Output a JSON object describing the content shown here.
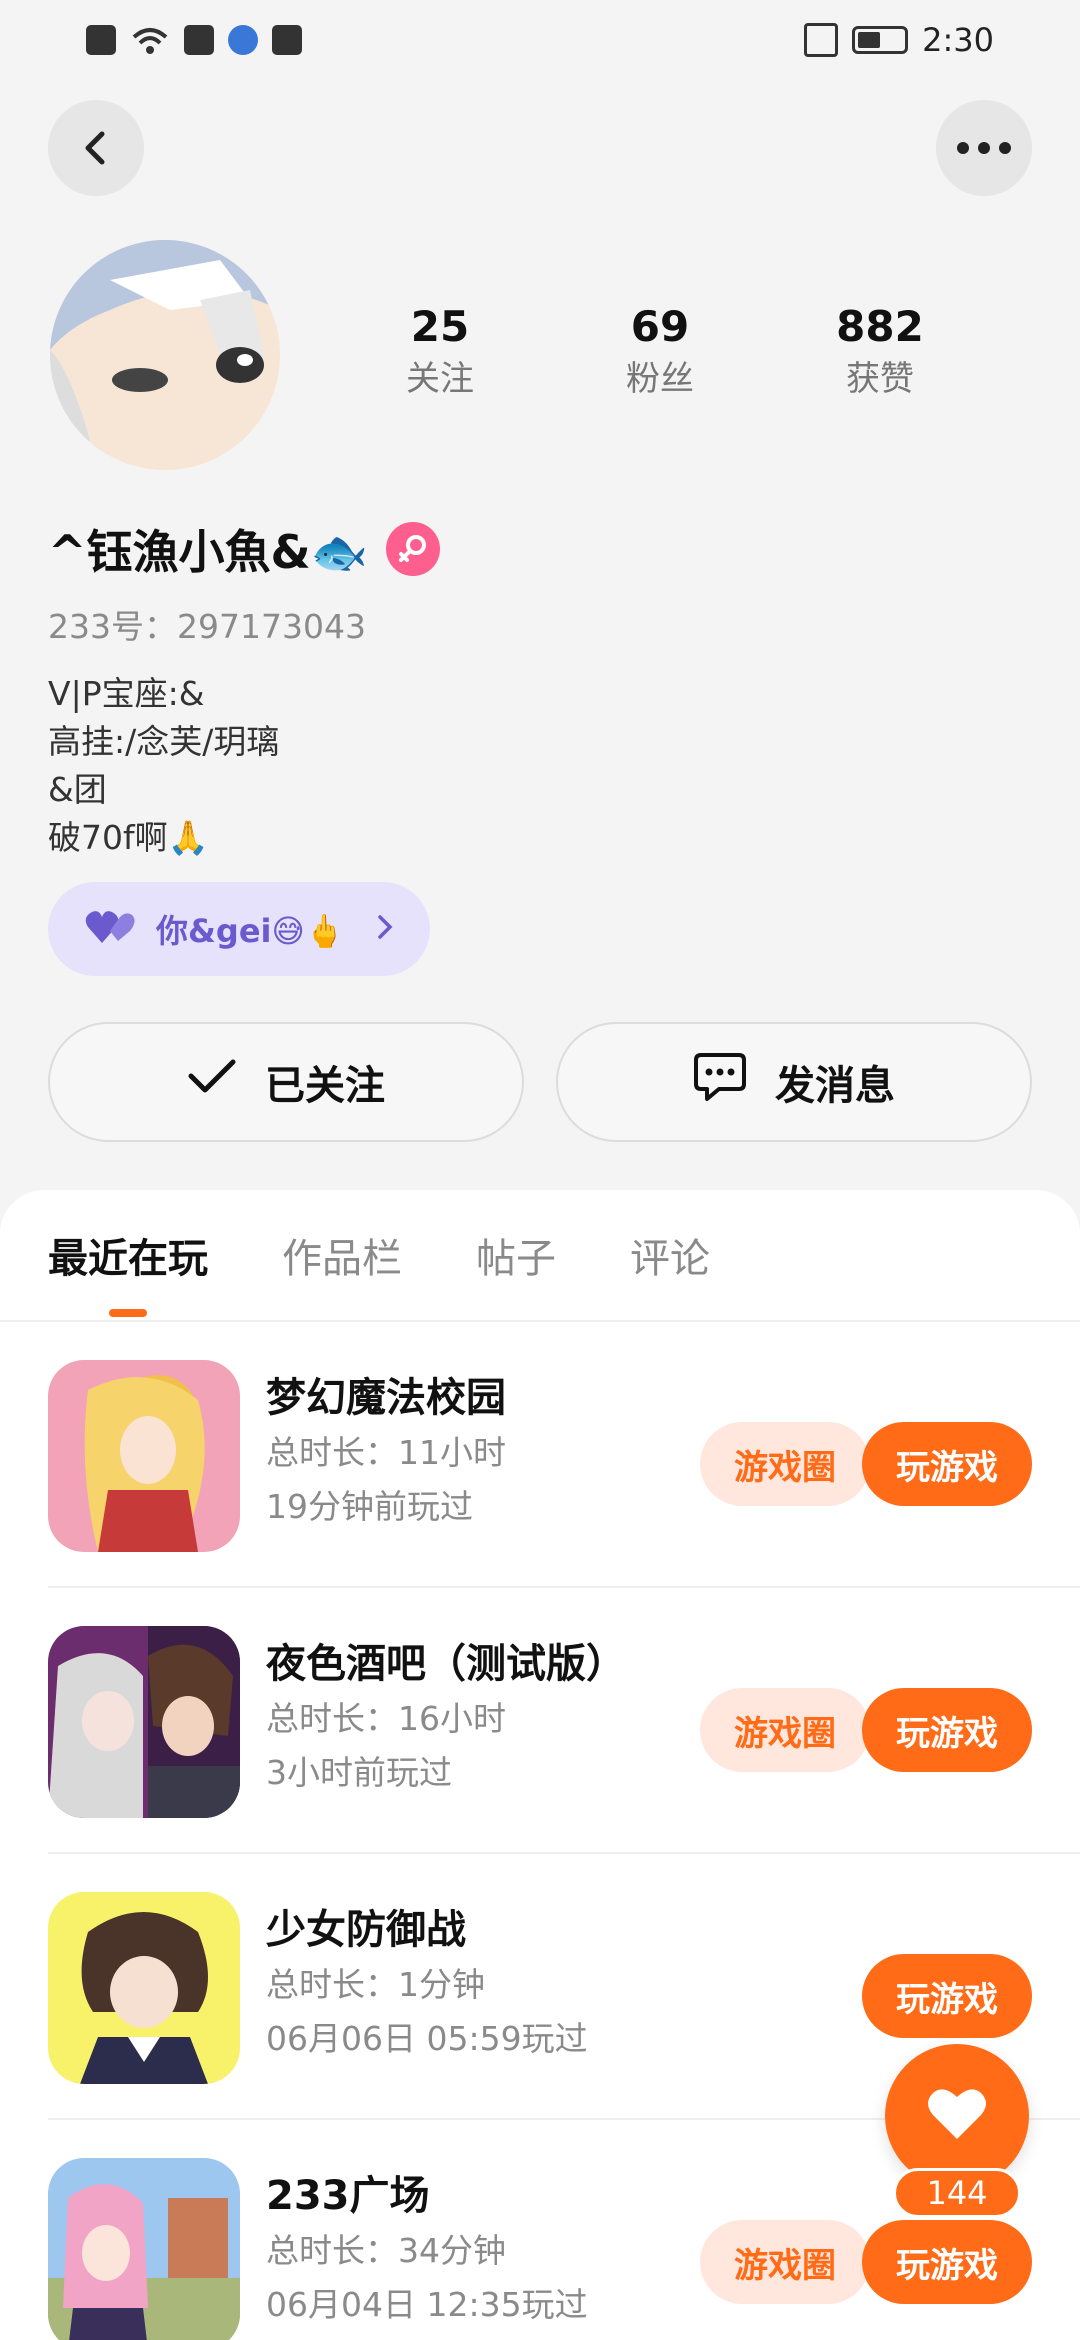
{
  "status_bar": {
    "time": "2:30",
    "icons": [
      "sim-alert-icon",
      "wifi-icon",
      "huawei-app-icon",
      "globe-icon",
      "huawei-app-icon",
      "vibrate-icon",
      "battery-icon"
    ]
  },
  "header": {
    "back_icon": "chevron-left-icon",
    "more_icon": "more-dots-icon"
  },
  "profile": {
    "stats": [
      {
        "value": "25",
        "label": "关注"
      },
      {
        "value": "69",
        "label": "粉丝"
      },
      {
        "value": "882",
        "label": "获赞"
      }
    ],
    "nickname": "^钰漁小魚&🐟",
    "gender_icon": "female-icon",
    "id_line": "233号：297173043",
    "bio_lines": [
      "V|P宝座:&",
      "高挂:/念芙/玥璃",
      "&团",
      "破70f啊🙏"
    ],
    "relation_label": "你&gei😅🖕",
    "follow_label": "已关注",
    "message_label": "发消息"
  },
  "tabs": [
    {
      "label": "最近在玩",
      "active": true
    },
    {
      "label": "作品栏",
      "active": false
    },
    {
      "label": "帖子",
      "active": false
    },
    {
      "label": "评论",
      "active": false
    }
  ],
  "games": [
    {
      "title": "梦幻魔法校园",
      "duration": "总时长：11小时",
      "last_played": "19分钟前玩过",
      "circle_label": "游戏圈",
      "play_label": "玩游戏",
      "has_circle": true
    },
    {
      "title": "夜色酒吧（测试版）",
      "duration": "总时长：16小时",
      "last_played": "3小时前玩过",
      "circle_label": "游戏圈",
      "play_label": "玩游戏",
      "has_circle": true
    },
    {
      "title": "少女防御战",
      "duration": "总时长：1分钟",
      "last_played": "06月06日 05:59玩过",
      "circle_label": "",
      "play_label": "玩游戏",
      "has_circle": false
    },
    {
      "title": "233广场",
      "duration": "总时长：34分钟",
      "last_played": "06月04日 12:35玩过",
      "circle_label": "游戏圈",
      "play_label": "玩游戏",
      "has_circle": true
    }
  ],
  "like_fab": {
    "count": "144",
    "icon": "heart-icon"
  },
  "colors": {
    "accent": "#ff6b17",
    "accent_light": "#ffe7dd",
    "relation_bg": "#e6e2fb",
    "relation_text": "#6a5acd",
    "female": "#ff5f8f"
  }
}
